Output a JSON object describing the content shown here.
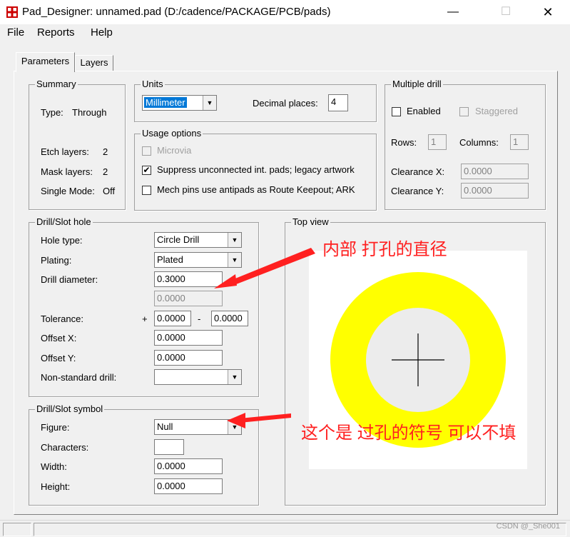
{
  "window": {
    "title": "Pad_Designer: unnamed.pad (D:/cadence/PACKAGE/PCB/pads)",
    "min_label": "—",
    "max_label": "☐",
    "close_label": "✕"
  },
  "menu": [
    {
      "label": "File"
    },
    {
      "label": "Reports"
    },
    {
      "label": "Help"
    }
  ],
  "tabs": [
    {
      "label": "Parameters"
    },
    {
      "label": "Layers"
    }
  ],
  "summary": {
    "title": "Summary",
    "type_label": "Type:",
    "type_value": "Through",
    "etch_label": "Etch layers:",
    "etch_value": "2",
    "mask_label": "Mask layers:",
    "mask_value": "2",
    "single_label": "Single Mode:",
    "single_value": "Off"
  },
  "units": {
    "title": "Units",
    "selected": "Millimeter",
    "decimal_label": "Decimal places:",
    "decimal_value": "4"
  },
  "usage": {
    "title": "Usage options",
    "microvia": "Microvia",
    "suppress": "Suppress unconnected int. pads; legacy artwork",
    "mech": "Mech pins use antipads as Route Keepout; ARK",
    "check_mark": "✔"
  },
  "multi": {
    "title": "Multiple drill",
    "enabled": "Enabled",
    "staggered": "Staggered",
    "rows_label": "Rows:",
    "rows_value": "1",
    "cols_label": "Columns:",
    "cols_value": "1",
    "clrx_label": "Clearance X:",
    "clrx_value": "0.0000",
    "clry_label": "Clearance Y:",
    "clry_value": "0.0000"
  },
  "drill": {
    "title": "Drill/Slot hole",
    "hole_type_label": "Hole type:",
    "hole_type": "Circle Drill",
    "plating_label": "Plating:",
    "plating": "Plated",
    "diameter_label": "Drill diameter:",
    "diameter": "0.3000",
    "diameter2": "0.0000",
    "tol_label": "Tolerance:",
    "tol_plus": "+",
    "tol_plus_value": "0.0000",
    "tol_minus": "-",
    "tol_minus_value": "0.0000",
    "offx_label": "Offset X:",
    "offx": "0.0000",
    "offy_label": "Offset Y:",
    "offy": "0.0000",
    "nonstd_label": "Non-standard drill:",
    "nonstd": ""
  },
  "symbol": {
    "title": "Drill/Slot symbol",
    "figure_label": "Figure:",
    "figure": "Null",
    "chars_label": "Characters:",
    "chars": "",
    "width_label": "Width:",
    "width": "0.0000",
    "height_label": "Height:",
    "height": "0.0000"
  },
  "topview": {
    "title": "Top view",
    "pad_color": "#ffff00",
    "hole_color": "#ececec"
  },
  "annotations": {
    "drill_note": "内部 打孔的直径",
    "symbol_note": "这个是 过孔的符号 可以不填",
    "color": "#ff2020"
  },
  "status": {
    "watermark": "CSDN @_She001"
  },
  "icons": {
    "app": "pad-designer-icon",
    "dropdown": "dropdown-arrow-icon"
  },
  "arrow_glyph": "▼"
}
